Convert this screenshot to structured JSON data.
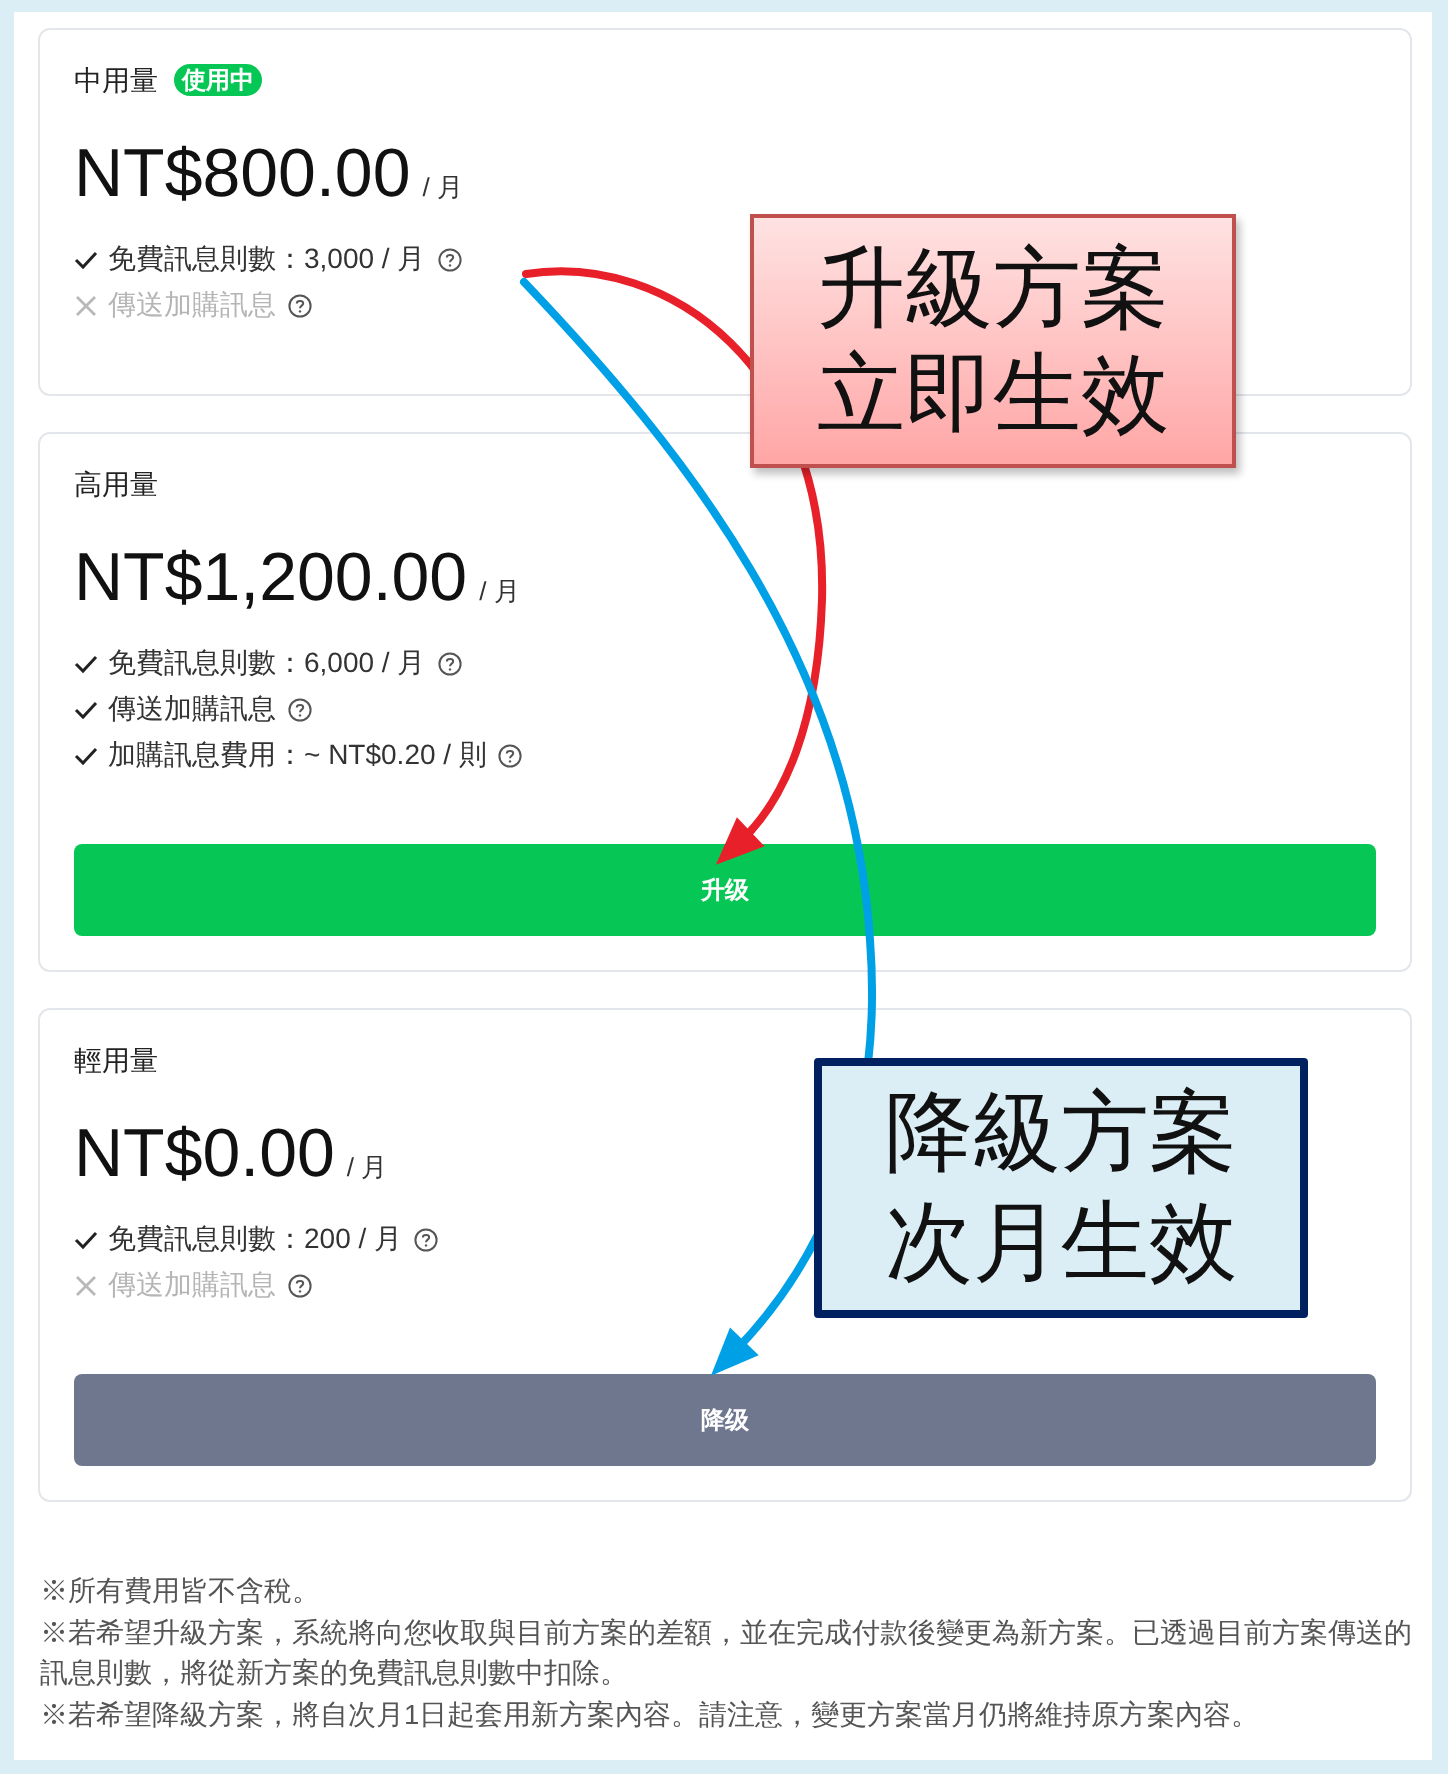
{
  "plans": [
    {
      "name": "中用量",
      "badge": "使用中",
      "price": "NT$800.00",
      "period": "/ 月",
      "features": [
        {
          "text": "免費訊息則數：3,000 / 月",
          "included": true
        },
        {
          "text": "傳送加購訊息",
          "included": false
        }
      ]
    },
    {
      "name": "高用量",
      "price": "NT$1,200.00",
      "period": "/ 月",
      "features": [
        {
          "text": "免費訊息則數：6,000 / 月",
          "included": true
        },
        {
          "text": "傳送加購訊息",
          "included": true
        },
        {
          "text": "加購訊息費用：~ NT$0.20 / 則",
          "included": true
        }
      ],
      "button": {
        "label": "升级",
        "kind": "upgrade"
      }
    },
    {
      "name": "輕用量",
      "price": "NT$0.00",
      "period": "/ 月",
      "features": [
        {
          "text": "免費訊息則數：200 / 月",
          "included": true
        },
        {
          "text": "傳送加購訊息",
          "included": false
        }
      ],
      "button": {
        "label": "降级",
        "kind": "downgrade"
      }
    }
  ],
  "notes": [
    "※所有費用皆不含稅。",
    "※若希望升級方案，系統將向您收取與目前方案的差額，並在完成付款後變更為新方案。已透過目前方案傳送的訊息則數，將從新方案的免費訊息則數中扣除。",
    "※若希望降級方案，將自次月1日起套用新方案內容。請注意，變更方案當月仍將維持原方案內容。"
  ],
  "callouts": [
    {
      "kind": "upgrade",
      "text": "升級方案立即生效"
    },
    {
      "kind": "downgrade",
      "text": "降級方案次月生效"
    }
  ]
}
